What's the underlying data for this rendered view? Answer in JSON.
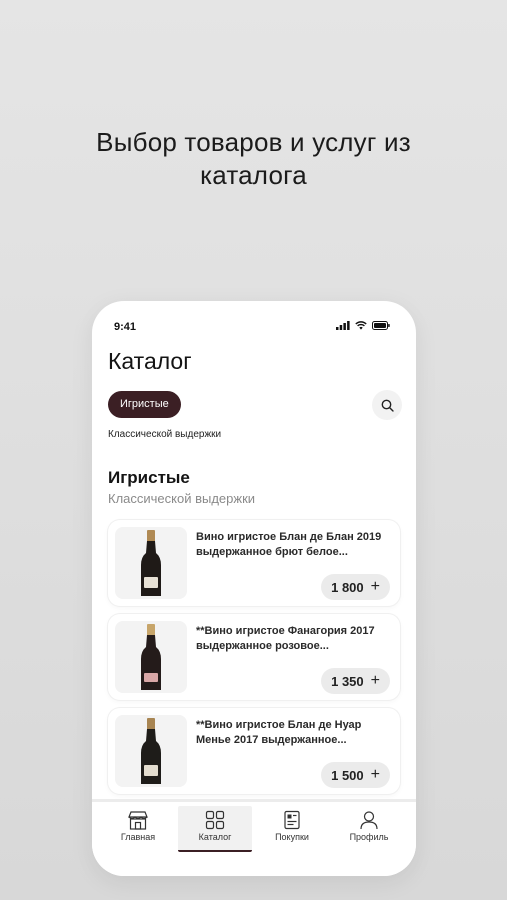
{
  "headline": {
    "line1": "Выбор товаров и услуг из",
    "line2": "каталога"
  },
  "status": {
    "time": "9:41"
  },
  "header": {
    "title": "Каталог"
  },
  "filters": {
    "active_chip": "Игристые",
    "sub_filter": "Классической выдержки"
  },
  "section": {
    "title": "Игристые",
    "subtitle": "Классической выдержки"
  },
  "products": [
    {
      "title": "Вино игристое Блан де Блан 2019 выдержанное брют белое...",
      "price": "1 800",
      "label_color": "#e8e2d6"
    },
    {
      "title": "**Вино игристое Фанагория 2017 выдержанное розовое...",
      "price": "1 350",
      "label_color": "#d9a7a7"
    },
    {
      "title": "**Вино игристое Блан де Нуар Менье 2017 выдержанное...",
      "price": "1 500",
      "label_color": "#e3ddcf"
    }
  ],
  "tabbar": {
    "items": [
      {
        "label": "Главная",
        "icon": "shop-icon"
      },
      {
        "label": "Каталог",
        "icon": "grid-icon",
        "active": true
      },
      {
        "label": "Покупки",
        "icon": "receipt-icon"
      },
      {
        "label": "Профиль",
        "icon": "user-icon"
      }
    ]
  },
  "colors": {
    "accent": "#3b1f24",
    "background": "#e0e0e0"
  }
}
